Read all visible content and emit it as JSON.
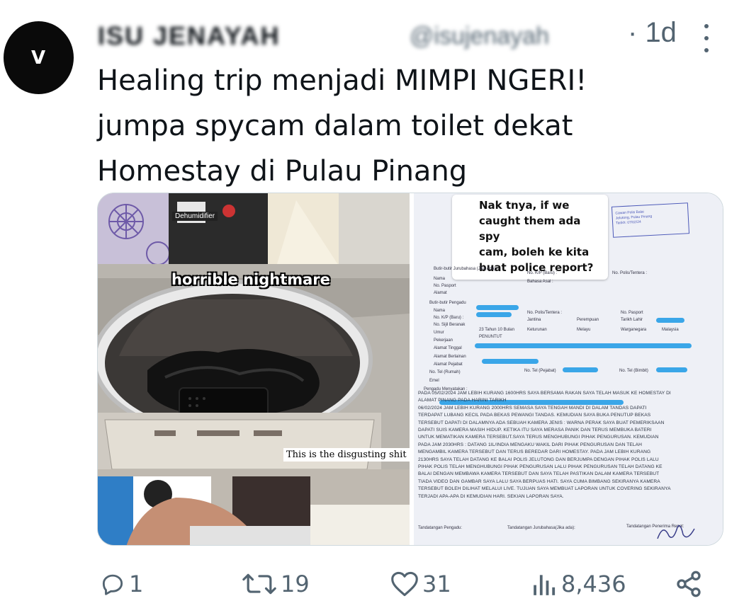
{
  "author": {
    "display_name": "ISU JENAYAH",
    "handle": "@isujenayah",
    "avatar_text": "V",
    "time_ago": "1d"
  },
  "tweet": {
    "lines": [
      "Healing trip menjadi MIMPI NGERI!",
      "jumpa spycam dalam toilet dekat",
      "Homestay di Pulau Pinang"
    ]
  },
  "media": {
    "left": {
      "label_top": "Dehumidifier",
      "caption_main": "horrible nightmare",
      "caption_sub": "This is the disgusting shit"
    },
    "right": {
      "chat_question": "Nak tnya, if we\ncaught them ada spy\ncam, boleh ke kita\nbuat police report?",
      "stamp_text": "Cawan Polis Balai\nJelutong, Pulau Pinang\nTarikh: 07/02/24",
      "form": {
        "section_interpreter": "Butir-butir Jurubahasa (Jika Ada) :",
        "ic_new": "No. K/P (Baru) :",
        "police_id": "No. Polis/Tentera :",
        "name": "Nama",
        "passport": "No. Pasport",
        "native_lang": "Bahasa Asal :",
        "address": "Alamat",
        "section_complainant": "Butir-butir Pengadu",
        "dob_cert": "No. Sijil Beranak",
        "age": "Umur",
        "age_value": "23 Tahun 10 Bulan",
        "gender": "Jantina",
        "gender_value": "Perempuan",
        "birthplace": "Tarikh Lahir",
        "race": "Keturunan",
        "race_value": "Melayu",
        "nationality": "Warganegara",
        "nationality_value": "Malaysia",
        "job": "Pekerjaan",
        "job_value": "PENUNTUT",
        "home_addr": "Alamat Tinggal",
        "other_addr": "Alamat Berlainan",
        "office_addr": "Alamat Pejabat",
        "tel_home": "No. Tel (Rumah)",
        "tel_office": "No. Tel (Pejabat)",
        "tel_mobile": "No. Tel (Bimbit)",
        "email": "Emel",
        "statement_title": "Pengadu Menyatakan :"
      },
      "statement_lines": [
        "PADA 05/02/2024 JAM LEBIH KURANG 1600HRS SAYA BERSAMA RAKAN SAYA TELAH MASUK KE HOMESTAY DI",
        "ALAMAT                                                                    PINANG PADA HARINI TARIKH",
        "06/02/2024 JAM LEBIH KURANG 2000HRS SEMASA SAYA TENGAH MANDI DI DALAM TANDAS DAPATI",
        "TERDAPAT LUBANG KECIL PADA BEKAS PEWANGI TANDAS. KEMUDIAN SAYA BUKA PENUTUP BEKAS",
        "TERSEBUT DAPATI DI DALAMNYA ADA SEBUAH KAMERA JENIS : WARNA PERAK SAYA BUAT PEMERIKSAAN",
        "DAPATI SUIS KAMERA MASIH HIDUP. KETIKA ITU SAYA MERASA PANIK DAN TERUS MEMBUKA BATERI",
        "UNTUK MEMATIKAN KAMERA TERSEBUT.SAYA TERUS MENGHUBUNGI PIHAK PENGURUSAN. KEMUDIAN",
        "PADA JAM 2030HRS : DATANG 1IL/INDIA MENGAKU WAKIL DARI PIHAK PENGURUSAN DAN TELAH",
        "MENGAMBIL KAMERA TERSEBUT DAN TERUS BEREDAR DARI HOMESTAY. PADA JAM LEBIH KURANG",
        "2130HRS SAYA TELAH DATANG KE BALAI POLIS JELUTONG DAN BERJUMPA DENGAN PIHAK POLIS LALU",
        "PIHAK POLIS TELAH MENGHUBUNGI PIHAK PENGURUSAN LALU PIHAK PENGURUSAN TELAH DATANG KE",
        "BALAI DENGAN MEMBAWA KAMERA TERSEBUT DAN SAYA TELAH PASTIKAN DALAM KAMERA TERSEBUT",
        "TIADA VIDEO DAN GAMBAR SAYA LALU SAYA BERPUAS HATI. SAYA CUMA BIMBANG SEKIRANYA KAMERA",
        "TERSEBUT BOLEH DILIHAT MELALUI LIVE. TUJUAN SAYA MEMBUAT LAPORAN UNTUK COVERING SEKIRANYA",
        "TERJADI APA-APA DI KEMUDIAN HARI. SEKIAN LAPORAN SAYA."
      ],
      "signatures": {
        "complainant": "Tandatangan Pengadu:",
        "interpreter": "Tandatangan Jurubahasa(Jika ada):",
        "receiver": "Tandatangan Penerima Repot:"
      }
    }
  },
  "actions": {
    "replies": "1",
    "reposts": "19",
    "likes": "31",
    "views": "8,436"
  },
  "colors": {
    "text": "#0f1419",
    "secondary": "#536471",
    "redaction": "#3aa6e8"
  }
}
